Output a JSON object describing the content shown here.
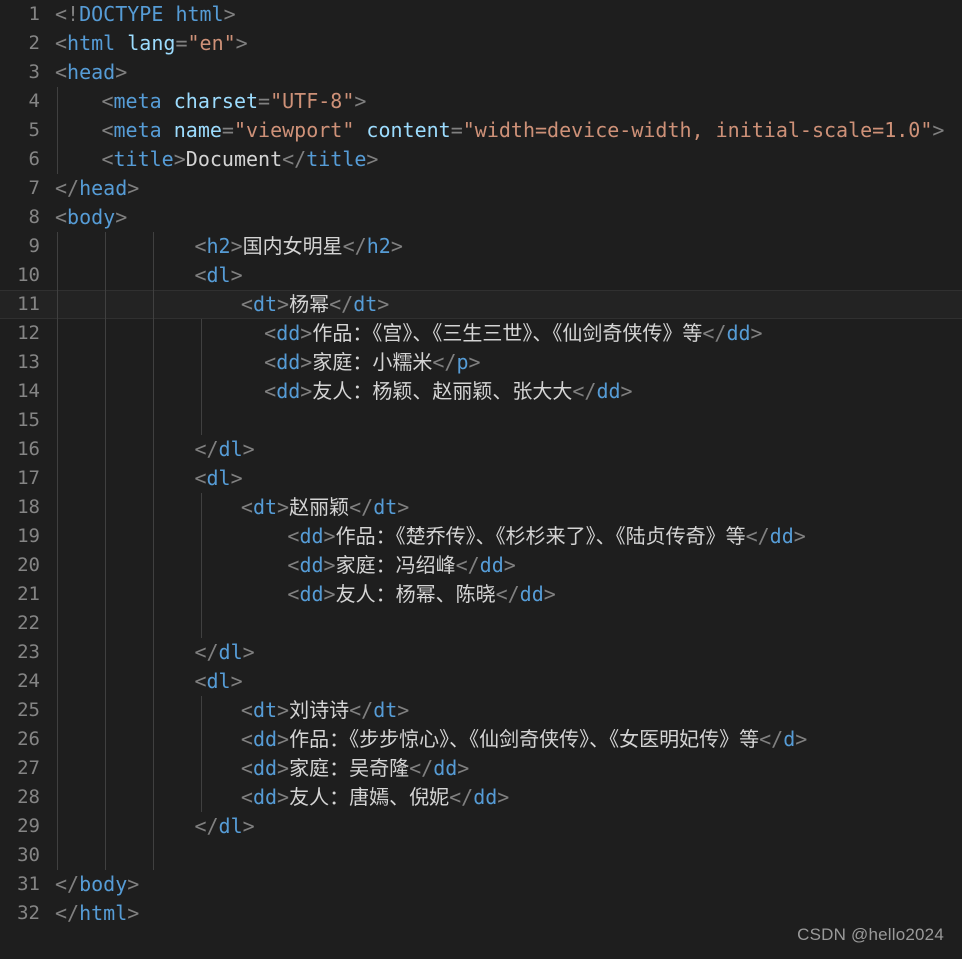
{
  "editor": {
    "theme_name": "dark-plus",
    "background_color": "#1e1e1e",
    "active_line_number": 11,
    "gutter_color": "#858585",
    "colors": {
      "bracket": "#808080",
      "tag": "#569cd6",
      "attribute": "#9cdcfe",
      "value": "#ce9178",
      "text": "#d4d4d4",
      "indent_guide": "#404040",
      "active_line": "#232323"
    },
    "language": "html",
    "indent_size": 4,
    "total_lines": 32
  },
  "watermark": {
    "text": "CSDN @hello2024"
  },
  "lines": [
    {
      "n": "1",
      "indent": 0,
      "guides": 0,
      "active": false,
      "tokens": [
        {
          "c": "br",
          "t": "<"
        },
        {
          "c": "bang",
          "t": "!"
        },
        {
          "c": "doc",
          "t": "DOCTYPE"
        },
        {
          "c": "txt",
          "t": " "
        },
        {
          "c": "doc",
          "t": "html"
        },
        {
          "c": "br",
          "t": ">"
        }
      ]
    },
    {
      "n": "2",
      "indent": 0,
      "guides": 0,
      "active": false,
      "tokens": [
        {
          "c": "br",
          "t": "<"
        },
        {
          "c": "tag",
          "t": "html"
        },
        {
          "c": "txt",
          "t": " "
        },
        {
          "c": "att",
          "t": "lang"
        },
        {
          "c": "br",
          "t": "="
        },
        {
          "c": "val",
          "t": "\"en\""
        },
        {
          "c": "br",
          "t": ">"
        }
      ]
    },
    {
      "n": "3",
      "indent": 0,
      "guides": 0,
      "active": false,
      "tokens": [
        {
          "c": "br",
          "t": "<"
        },
        {
          "c": "tag",
          "t": "head"
        },
        {
          "c": "br",
          "t": ">"
        }
      ]
    },
    {
      "n": "4",
      "indent": 4,
      "guides": 1,
      "active": false,
      "tokens": [
        {
          "c": "br",
          "t": "<"
        },
        {
          "c": "tag",
          "t": "meta"
        },
        {
          "c": "txt",
          "t": " "
        },
        {
          "c": "att",
          "t": "charset"
        },
        {
          "c": "br",
          "t": "="
        },
        {
          "c": "val",
          "t": "\"UTF-8\""
        },
        {
          "c": "br",
          "t": ">"
        }
      ]
    },
    {
      "n": "5",
      "indent": 4,
      "guides": 1,
      "active": false,
      "tokens": [
        {
          "c": "br",
          "t": "<"
        },
        {
          "c": "tag",
          "t": "meta"
        },
        {
          "c": "txt",
          "t": " "
        },
        {
          "c": "att",
          "t": "name"
        },
        {
          "c": "br",
          "t": "="
        },
        {
          "c": "val",
          "t": "\"viewport\""
        },
        {
          "c": "txt",
          "t": " "
        },
        {
          "c": "att",
          "t": "content"
        },
        {
          "c": "br",
          "t": "="
        },
        {
          "c": "val",
          "t": "\"width=device-width, initial-scale=1.0\""
        },
        {
          "c": "br",
          "t": ">"
        }
      ]
    },
    {
      "n": "6",
      "indent": 4,
      "guides": 1,
      "active": false,
      "tokens": [
        {
          "c": "br",
          "t": "<"
        },
        {
          "c": "tag",
          "t": "title"
        },
        {
          "c": "br",
          "t": ">"
        },
        {
          "c": "txt",
          "t": "Document"
        },
        {
          "c": "br",
          "t": "</"
        },
        {
          "c": "tag",
          "t": "title"
        },
        {
          "c": "br",
          "t": ">"
        }
      ]
    },
    {
      "n": "7",
      "indent": 0,
      "guides": 0,
      "active": false,
      "tokens": [
        {
          "c": "br",
          "t": "</"
        },
        {
          "c": "tag",
          "t": "head"
        },
        {
          "c": "br",
          "t": ">"
        }
      ]
    },
    {
      "n": "8",
      "indent": 0,
      "guides": 0,
      "active": false,
      "tokens": [
        {
          "c": "br",
          "t": "<"
        },
        {
          "c": "tag",
          "t": "body"
        },
        {
          "c": "br",
          "t": ">"
        }
      ]
    },
    {
      "n": "9",
      "indent": 12,
      "guides": 3,
      "active": false,
      "tokens": [
        {
          "c": "br",
          "t": "<"
        },
        {
          "c": "tag",
          "t": "h2"
        },
        {
          "c": "br",
          "t": ">"
        },
        {
          "c": "txt",
          "t": "国内女明星"
        },
        {
          "c": "br",
          "t": "</"
        },
        {
          "c": "tag",
          "t": "h2"
        },
        {
          "c": "br",
          "t": ">"
        }
      ]
    },
    {
      "n": "10",
      "indent": 12,
      "guides": 3,
      "active": false,
      "tokens": [
        {
          "c": "br",
          "t": "<"
        },
        {
          "c": "tag",
          "t": "dl"
        },
        {
          "c": "br",
          "t": ">"
        }
      ]
    },
    {
      "n": "11",
      "indent": 16,
      "guides": 3,
      "active": true,
      "tokens": [
        {
          "c": "br",
          "t": "<"
        },
        {
          "c": "tag",
          "t": "dt"
        },
        {
          "c": "br",
          "t": ">"
        },
        {
          "c": "txt",
          "t": "杨幂"
        },
        {
          "c": "br",
          "t": "</"
        },
        {
          "c": "tag",
          "t": "dt"
        },
        {
          "c": "br",
          "t": ">"
        }
      ]
    },
    {
      "n": "12",
      "indent": 18,
      "guides": 4,
      "active": false,
      "tokens": [
        {
          "c": "br",
          "t": "<"
        },
        {
          "c": "tag",
          "t": "dd"
        },
        {
          "c": "br",
          "t": ">"
        },
        {
          "c": "txt",
          "t": "作品：《宫》、《三生三世》、《仙剑奇侠传》等"
        },
        {
          "c": "br",
          "t": "</"
        },
        {
          "c": "tag",
          "t": "dd"
        },
        {
          "c": "br",
          "t": ">"
        }
      ]
    },
    {
      "n": "13",
      "indent": 18,
      "guides": 4,
      "active": false,
      "tokens": [
        {
          "c": "br",
          "t": "<"
        },
        {
          "c": "tag",
          "t": "dd"
        },
        {
          "c": "br",
          "t": ">"
        },
        {
          "c": "txt",
          "t": "家庭：小糯米"
        },
        {
          "c": "br",
          "t": "</"
        },
        {
          "c": "tag",
          "t": "p"
        },
        {
          "c": "br",
          "t": ">"
        }
      ]
    },
    {
      "n": "14",
      "indent": 18,
      "guides": 4,
      "active": false,
      "tokens": [
        {
          "c": "br",
          "t": "<"
        },
        {
          "c": "tag",
          "t": "dd"
        },
        {
          "c": "br",
          "t": ">"
        },
        {
          "c": "txt",
          "t": "友人：杨颖、赵丽颖、张大大"
        },
        {
          "c": "br",
          "t": "</"
        },
        {
          "c": "tag",
          "t": "dd"
        },
        {
          "c": "br",
          "t": ">"
        }
      ]
    },
    {
      "n": "15",
      "indent": 0,
      "guides": 4,
      "active": false,
      "tokens": []
    },
    {
      "n": "16",
      "indent": 12,
      "guides": 3,
      "active": false,
      "tokens": [
        {
          "c": "br",
          "t": "</"
        },
        {
          "c": "tag",
          "t": "dl"
        },
        {
          "c": "br",
          "t": ">"
        }
      ]
    },
    {
      "n": "17",
      "indent": 12,
      "guides": 3,
      "active": false,
      "tokens": [
        {
          "c": "br",
          "t": "<"
        },
        {
          "c": "tag",
          "t": "dl"
        },
        {
          "c": "br",
          "t": ">"
        }
      ]
    },
    {
      "n": "18",
      "indent": 16,
      "guides": 4,
      "active": false,
      "tokens": [
        {
          "c": "br",
          "t": "<"
        },
        {
          "c": "tag",
          "t": "dt"
        },
        {
          "c": "br",
          "t": ">"
        },
        {
          "c": "txt",
          "t": "赵丽颖"
        },
        {
          "c": "br",
          "t": "</"
        },
        {
          "c": "tag",
          "t": "dt"
        },
        {
          "c": "br",
          "t": ">"
        }
      ]
    },
    {
      "n": "19",
      "indent": 20,
      "guides": 4,
      "active": false,
      "tokens": [
        {
          "c": "br",
          "t": "<"
        },
        {
          "c": "tag",
          "t": "dd"
        },
        {
          "c": "br",
          "t": ">"
        },
        {
          "c": "txt",
          "t": "作品：《楚乔传》、《杉杉来了》、《陆贞传奇》等"
        },
        {
          "c": "br",
          "t": "</"
        },
        {
          "c": "tag",
          "t": "dd"
        },
        {
          "c": "br",
          "t": ">"
        }
      ]
    },
    {
      "n": "20",
      "indent": 20,
      "guides": 4,
      "active": false,
      "tokens": [
        {
          "c": "br",
          "t": "<"
        },
        {
          "c": "tag",
          "t": "dd"
        },
        {
          "c": "br",
          "t": ">"
        },
        {
          "c": "txt",
          "t": "家庭：冯绍峰"
        },
        {
          "c": "br",
          "t": "</"
        },
        {
          "c": "tag",
          "t": "dd"
        },
        {
          "c": "br",
          "t": ">"
        }
      ]
    },
    {
      "n": "21",
      "indent": 20,
      "guides": 4,
      "active": false,
      "tokens": [
        {
          "c": "br",
          "t": "<"
        },
        {
          "c": "tag",
          "t": "dd"
        },
        {
          "c": "br",
          "t": ">"
        },
        {
          "c": "txt",
          "t": "友人：杨幂、陈晓"
        },
        {
          "c": "br",
          "t": "</"
        },
        {
          "c": "tag",
          "t": "dd"
        },
        {
          "c": "br",
          "t": ">"
        }
      ]
    },
    {
      "n": "22",
      "indent": 0,
      "guides": 4,
      "active": false,
      "tokens": []
    },
    {
      "n": "23",
      "indent": 12,
      "guides": 3,
      "active": false,
      "tokens": [
        {
          "c": "br",
          "t": "</"
        },
        {
          "c": "tag",
          "t": "dl"
        },
        {
          "c": "br",
          "t": ">"
        }
      ]
    },
    {
      "n": "24",
      "indent": 12,
      "guides": 3,
      "active": false,
      "tokens": [
        {
          "c": "br",
          "t": "<"
        },
        {
          "c": "tag",
          "t": "dl"
        },
        {
          "c": "br",
          "t": ">"
        }
      ]
    },
    {
      "n": "25",
      "indent": 16,
      "guides": 4,
      "active": false,
      "tokens": [
        {
          "c": "br",
          "t": "<"
        },
        {
          "c": "tag",
          "t": "dt"
        },
        {
          "c": "br",
          "t": ">"
        },
        {
          "c": "txt",
          "t": "刘诗诗"
        },
        {
          "c": "br",
          "t": "</"
        },
        {
          "c": "tag",
          "t": "dt"
        },
        {
          "c": "br",
          "t": ">"
        }
      ]
    },
    {
      "n": "26",
      "indent": 16,
      "guides": 4,
      "active": false,
      "tokens": [
        {
          "c": "br",
          "t": "<"
        },
        {
          "c": "tag",
          "t": "dd"
        },
        {
          "c": "br",
          "t": ">"
        },
        {
          "c": "txt",
          "t": "作品：《步步惊心》、《仙剑奇侠传》、《女医明妃传》等"
        },
        {
          "c": "br",
          "t": "</"
        },
        {
          "c": "tag",
          "t": "d"
        },
        {
          "c": "br",
          "t": ">"
        }
      ]
    },
    {
      "n": "27",
      "indent": 16,
      "guides": 4,
      "active": false,
      "tokens": [
        {
          "c": "br",
          "t": "<"
        },
        {
          "c": "tag",
          "t": "dd"
        },
        {
          "c": "br",
          "t": ">"
        },
        {
          "c": "txt",
          "t": "家庭：吴奇隆"
        },
        {
          "c": "br",
          "t": "</"
        },
        {
          "c": "tag",
          "t": "dd"
        },
        {
          "c": "br",
          "t": ">"
        }
      ]
    },
    {
      "n": "28",
      "indent": 16,
      "guides": 4,
      "active": false,
      "tokens": [
        {
          "c": "br",
          "t": "<"
        },
        {
          "c": "tag",
          "t": "dd"
        },
        {
          "c": "br",
          "t": ">"
        },
        {
          "c": "txt",
          "t": "友人：唐嫣、倪妮"
        },
        {
          "c": "br",
          "t": "</"
        },
        {
          "c": "tag",
          "t": "dd"
        },
        {
          "c": "br",
          "t": ">"
        }
      ]
    },
    {
      "n": "29",
      "indent": 12,
      "guides": 3,
      "active": false,
      "tokens": [
        {
          "c": "br",
          "t": "</"
        },
        {
          "c": "tag",
          "t": "dl"
        },
        {
          "c": "br",
          "t": ">"
        }
      ]
    },
    {
      "n": "30",
      "indent": 0,
      "guides": 3,
      "active": false,
      "tokens": []
    },
    {
      "n": "31",
      "indent": 0,
      "guides": 0,
      "active": false,
      "tokens": [
        {
          "c": "br",
          "t": "</"
        },
        {
          "c": "tag",
          "t": "body"
        },
        {
          "c": "br",
          "t": ">"
        }
      ]
    },
    {
      "n": "32",
      "indent": 0,
      "guides": 0,
      "active": false,
      "tokens": [
        {
          "c": "br",
          "t": "</"
        },
        {
          "c": "tag",
          "t": "html"
        },
        {
          "c": "br",
          "t": ">"
        }
      ]
    }
  ]
}
